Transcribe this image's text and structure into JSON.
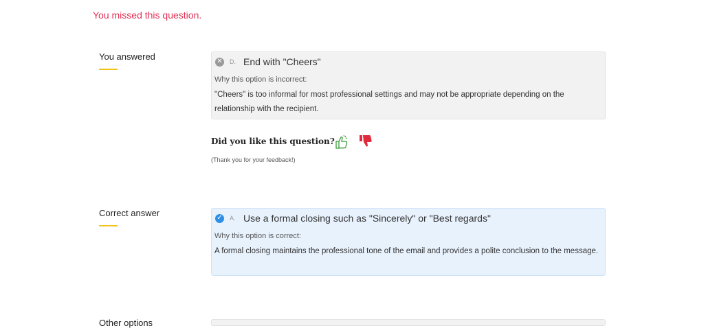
{
  "status": {
    "missed_text": "You missed this question."
  },
  "your_answer": {
    "label": "You answered",
    "letter": "D.",
    "text": "End with \"Cheers\"",
    "why_label": "Why this option is incorrect:",
    "explanation": "\"Cheers\" is too informal for most professional settings and may not be appropriate depending on the relationship with the recipient.",
    "icon": "x-circle-icon"
  },
  "feedback": {
    "question": "Did you like this question?",
    "thanks": "(Thank you for your feedback!)",
    "like_icon": "thumbs-up-icon",
    "dislike_icon": "thumbs-down-icon",
    "like_color": "#3a9a3a",
    "dislike_color": "#e02a3e"
  },
  "correct_answer": {
    "label": "Correct answer",
    "letter": "A.",
    "text": "Use a formal closing such as \"Sincerely\" or \"Best regards\"",
    "why_label": "Why this option is correct:",
    "explanation": "A formal closing maintains the professional tone of the email and provides a polite conclusion to the message.",
    "icon": "check-circle-icon"
  },
  "other_options": {
    "label": "Other options"
  },
  "colors": {
    "error": "#e03155",
    "accent_underline": "#f0c419",
    "correct_bg": "#e8f2fd",
    "incorrect_bg": "#f2f2f2"
  }
}
